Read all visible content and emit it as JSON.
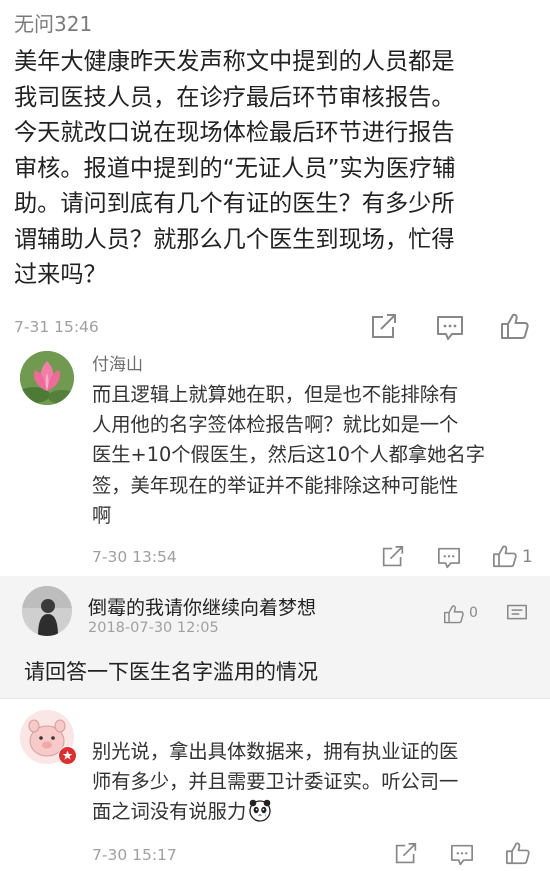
{
  "main_comment": {
    "username": "无问321",
    "lines": [
      "美年大健康昨天发声称文中提到的人员都是",
      "我司医技人员，在诊疗最后环节审核报告。",
      "今天就改口说在现场体检最后环节进行报告",
      "审核。报道中提到的“无证人员”实为医疗辅",
      "助。请问到底有几个有证的医生？有多少所",
      "谓辅助人员？就那么几个医生到现场，忙得",
      "过来吗？"
    ],
    "time": "7-31 15:46"
  },
  "reply1": {
    "username": "付海山",
    "lines": [
      "而且逻辑上就算她在职，但是也不能排除有",
      "人用他的名字签体检报告啊？就比如是一个",
      "医生+10个假医生，然后这10个人都拿她名字",
      "签，美年现在的举证并不能排除这种可能性",
      "啊"
    ],
    "time": "7-30 13:54",
    "like_count": "1"
  },
  "reply2": {
    "username": "倒霉的我请你继续向着梦想",
    "time": "2018-07-30 12:05",
    "like_count": "0",
    "text": "请回答一下医生名字滥用的情况"
  },
  "reply3": {
    "lines": [
      "别光说，拿出具体数据来，拥有执业证的医",
      "师有多少，并且需要卫计委证实。听公司一",
      "面之词没有说服力"
    ],
    "time": "7-30 15:17"
  },
  "icons": {
    "share": "share-icon",
    "comment": "comment-icon",
    "like": "thumbs-up-icon"
  },
  "colors": {
    "background": "#ffffff",
    "band": "#f4f4f4",
    "muted_text": "#9a9a9a",
    "verified_badge": "#e02d2d"
  }
}
